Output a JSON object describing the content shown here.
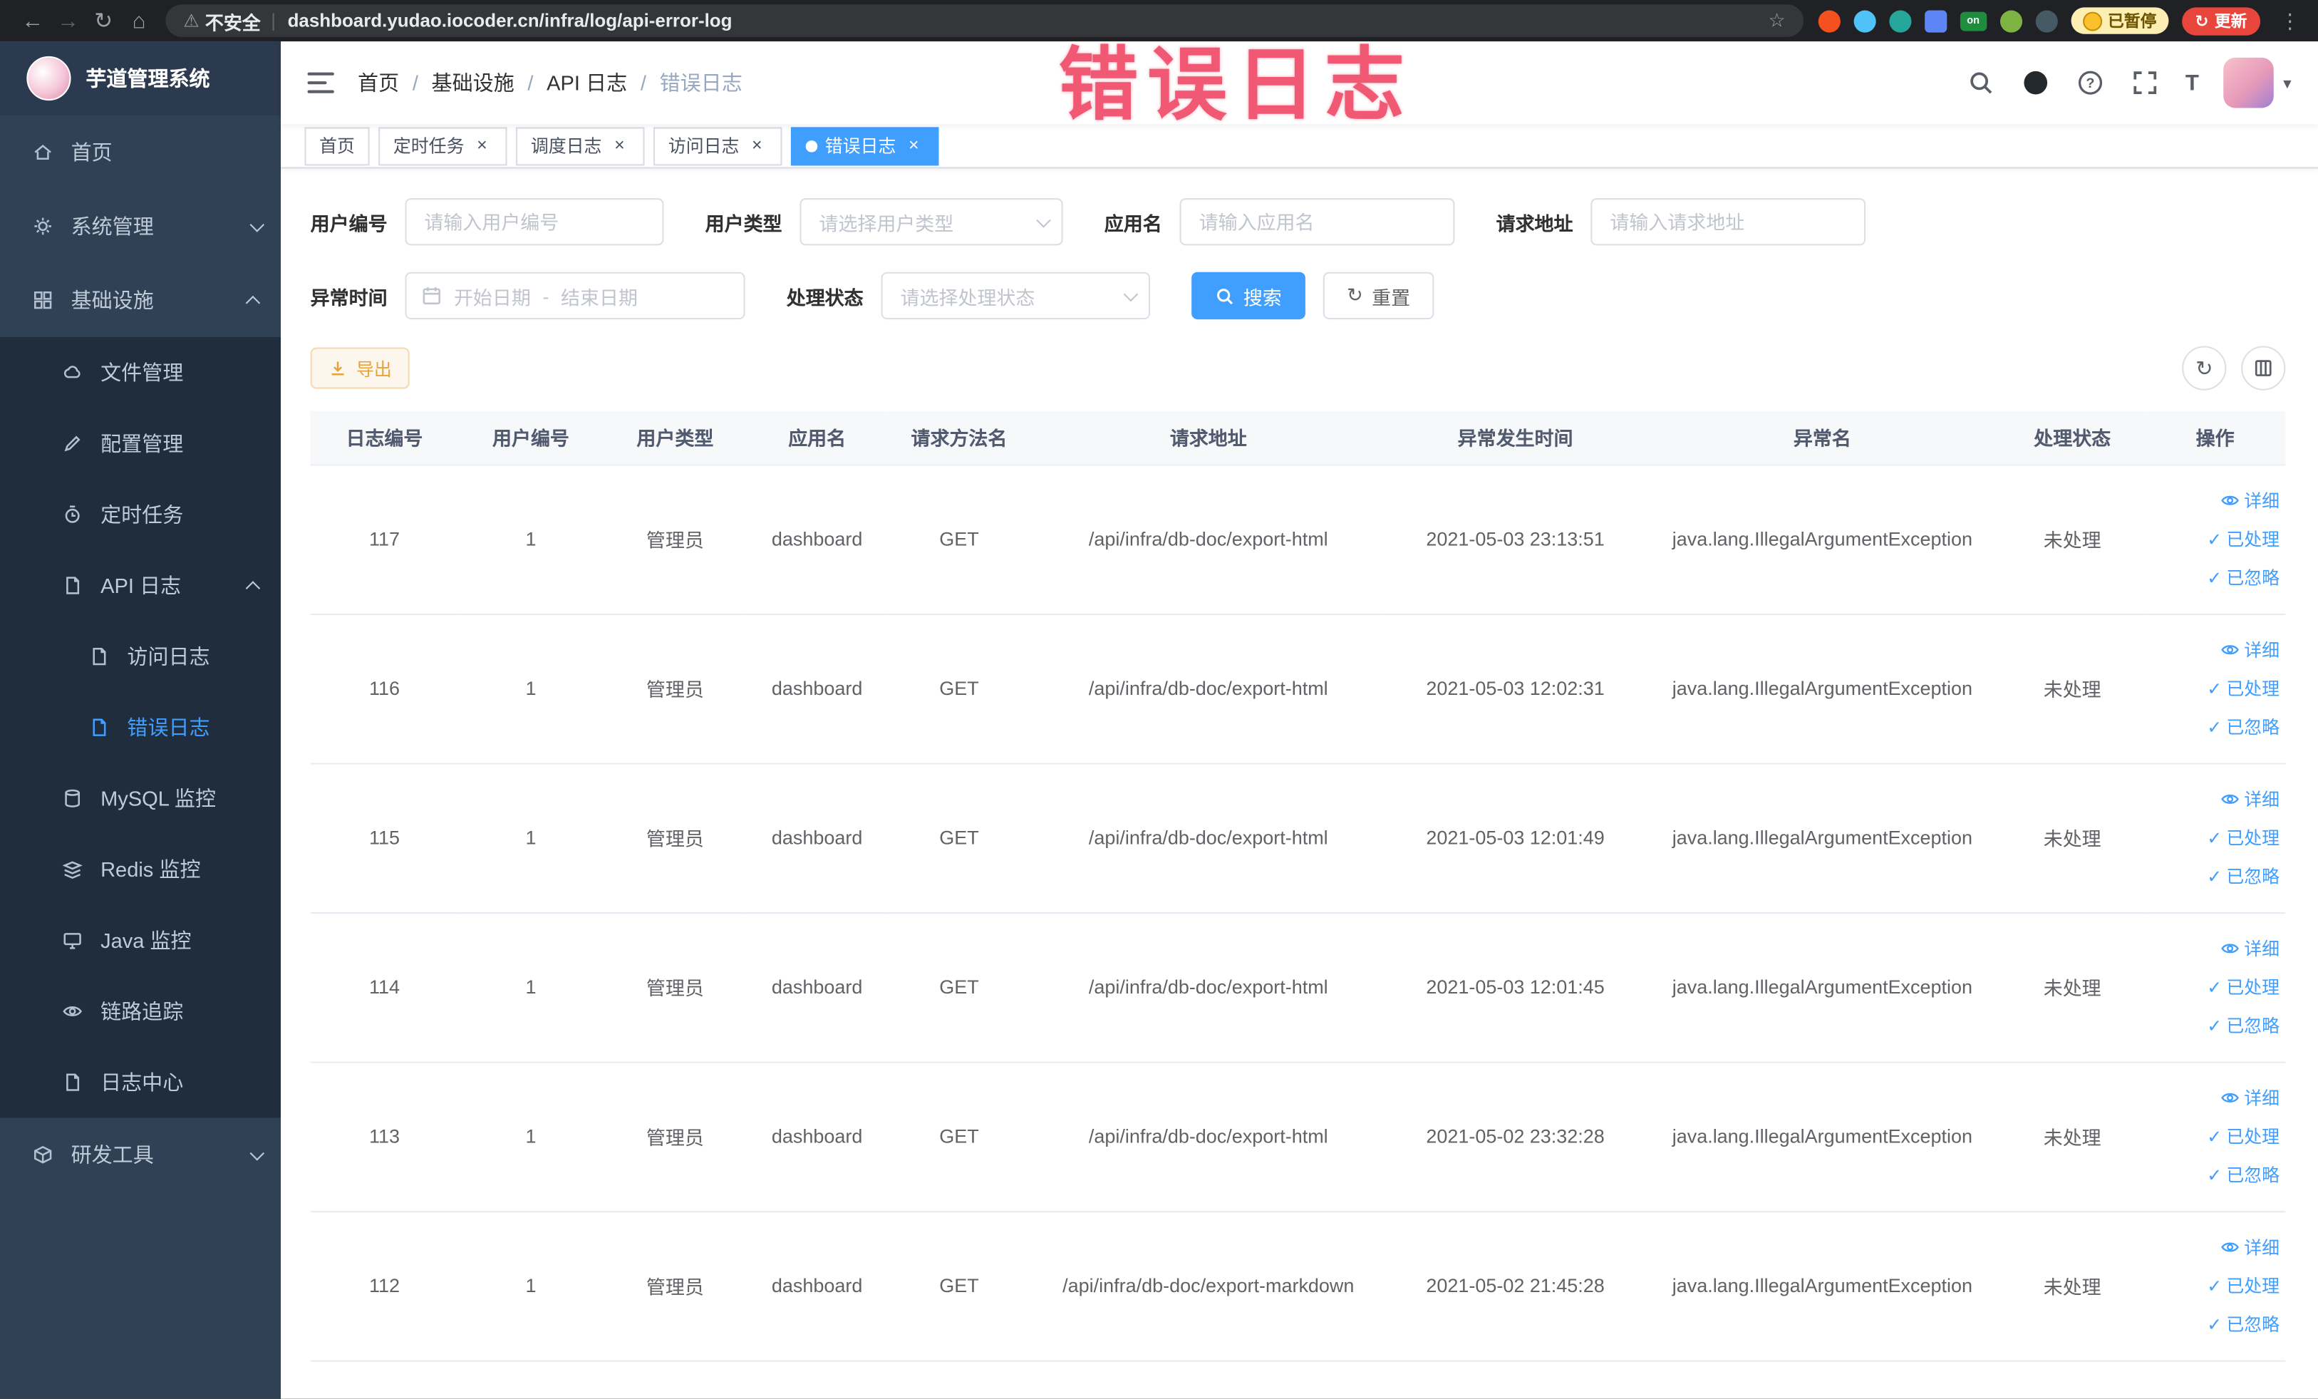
{
  "glyphs": {
    "back": "←",
    "forward": "→",
    "refresh": "↻",
    "home": "⌂",
    "warning": "⚠",
    "star": "☆",
    "menu_dots": "⋮",
    "divider": "|",
    "close": "×",
    "caret": "▾",
    "check": "✓",
    "slash": "/",
    "question": "?"
  },
  "browser": {
    "security_label": "不安全",
    "url": "dashboard.yudao.iocoder.cn/infra/log/api-error-log",
    "extension_badge_on": "on",
    "paused_badge": "已暂停",
    "update_button": "更新"
  },
  "annotation": {
    "text": "错误日志"
  },
  "sidebar": {
    "logo_title": "芋道管理系统",
    "items": {
      "home": "首页",
      "system": "系统管理",
      "infra": "基础设施",
      "file": "文件管理",
      "config": "配置管理",
      "job": "定时任务",
      "apilog": "API 日志",
      "accesslog": "访问日志",
      "errorlog": "错误日志",
      "mysql": "MySQL 监控",
      "redis": "Redis 监控",
      "java": "Java 监控",
      "trace": "链路追踪",
      "logcenter": "日志中心",
      "devtools": "研发工具"
    }
  },
  "breadcrumb": [
    "首页",
    "基础设施",
    "API 日志",
    "错误日志"
  ],
  "tabs": [
    {
      "label": "首页"
    },
    {
      "label": "定时任务"
    },
    {
      "label": "调度日志"
    },
    {
      "label": "访问日志"
    },
    {
      "label": "错误日志"
    }
  ],
  "filters": {
    "user_id_label": "用户编号",
    "user_id_placeholder": "请输入用户编号",
    "user_type_label": "用户类型",
    "user_type_placeholder": "请选择用户类型",
    "app_name_label": "应用名",
    "app_name_placeholder": "请输入应用名",
    "request_url_label": "请求地址",
    "request_url_placeholder": "请输入请求地址",
    "exception_time_label": "异常时间",
    "start_date_placeholder": "开始日期",
    "range_separator": "-",
    "end_date_placeholder": "结束日期",
    "process_status_label": "处理状态",
    "process_status_placeholder": "请选择处理状态",
    "search_button": "搜索",
    "reset_button": "重置"
  },
  "toolbar": {
    "export_button": "导出"
  },
  "table": {
    "headers": [
      "日志编号",
      "用户编号",
      "用户类型",
      "应用名",
      "请求方法名",
      "请求地址",
      "异常发生时间",
      "异常名",
      "处理状态",
      "操作"
    ],
    "action_labels": [
      "详细",
      "已处理",
      "已忽略"
    ],
    "rows": [
      {
        "id": "117",
        "user_id": "1",
        "user_type": "管理员",
        "app": "dashboard",
        "method": "GET",
        "url": "/api/infra/db-doc/export-html",
        "time": "2021-05-03 23:13:51",
        "exception": "java.lang.IllegalArgumentException",
        "status": "未处理"
      },
      {
        "id": "116",
        "user_id": "1",
        "user_type": "管理员",
        "app": "dashboard",
        "method": "GET",
        "url": "/api/infra/db-doc/export-html",
        "time": "2021-05-03 12:02:31",
        "exception": "java.lang.IllegalArgumentException",
        "status": "未处理"
      },
      {
        "id": "115",
        "user_id": "1",
        "user_type": "管理员",
        "app": "dashboard",
        "method": "GET",
        "url": "/api/infra/db-doc/export-html",
        "time": "2021-05-03 12:01:49",
        "exception": "java.lang.IllegalArgumentException",
        "status": "未处理"
      },
      {
        "id": "114",
        "user_id": "1",
        "user_type": "管理员",
        "app": "dashboard",
        "method": "GET",
        "url": "/api/infra/db-doc/export-html",
        "time": "2021-05-03 12:01:45",
        "exception": "java.lang.IllegalArgumentException",
        "status": "未处理"
      },
      {
        "id": "113",
        "user_id": "1",
        "user_type": "管理员",
        "app": "dashboard",
        "method": "GET",
        "url": "/api/infra/db-doc/export-html",
        "time": "2021-05-02 23:32:28",
        "exception": "java.lang.IllegalArgumentException",
        "status": "未处理"
      },
      {
        "id": "112",
        "user_id": "1",
        "user_type": "管理员",
        "app": "dashboard",
        "method": "GET",
        "url": "/api/infra/db-doc/export-markdown",
        "time": "2021-05-02 21:45:28",
        "exception": "java.lang.IllegalArgumentException",
        "status": "未处理"
      }
    ]
  },
  "colors": {
    "primary": "#409eff",
    "sidebar_bg": "#304156",
    "submenu_bg": "#1f2d3d",
    "warning": "#e6a23c",
    "annotation": "#ee4160"
  }
}
